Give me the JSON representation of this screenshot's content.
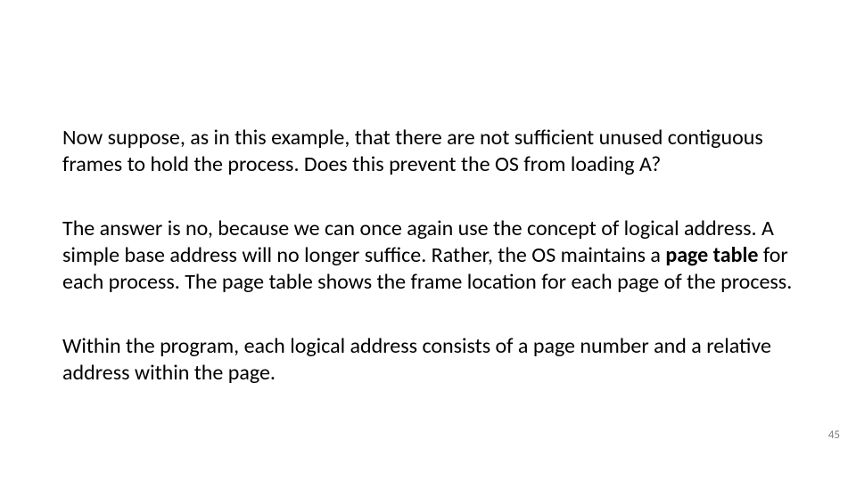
{
  "slide": {
    "para1": "Now suppose, as in this example, that there are not sufficient unused contiguous frames to hold the process. Does this prevent the OS from loading A?",
    "para2_a": "The answer is no, because we can once again use the concept of logical address. A simple base address will no longer suffice. Rather, the OS maintains a ",
    "para2_bold": "page table",
    "para2_b": " for each process. The page table shows the frame location for each page of the process.",
    "para3": "Within the program, each logical address consists of a page number and a relative address within the page.",
    "page_number": "45"
  }
}
